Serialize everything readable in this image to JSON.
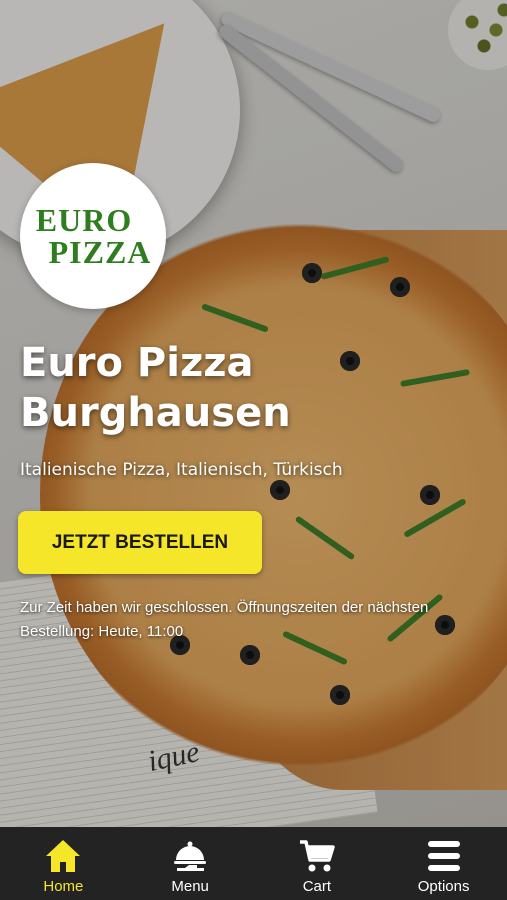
{
  "brand": {
    "logo_line1": "EURO",
    "logo_line2": "PIZZA",
    "logo_color": "#2e7d1e"
  },
  "hero": {
    "title": "Euro Pizza Burghausen",
    "subtitle": "Italienische Pizza, Italienisch, Türkisch",
    "order_button": "JETZT BESTELLEN",
    "notice": "Zur Zeit haben wir geschlossen. Öffnungszeiten der nächsten Bestellung: Heute, 11:00",
    "background_word": "ique"
  },
  "colors": {
    "accent": "#f6e62a",
    "nav_background": "#232323"
  },
  "nav": {
    "items": [
      {
        "label": "Home",
        "icon": "home-icon",
        "active": true
      },
      {
        "label": "Menu",
        "icon": "serving-cloche-icon",
        "active": false
      },
      {
        "label": "Cart",
        "icon": "cart-icon",
        "active": false
      },
      {
        "label": "Options",
        "icon": "hamburger-menu-icon",
        "active": false
      }
    ]
  }
}
